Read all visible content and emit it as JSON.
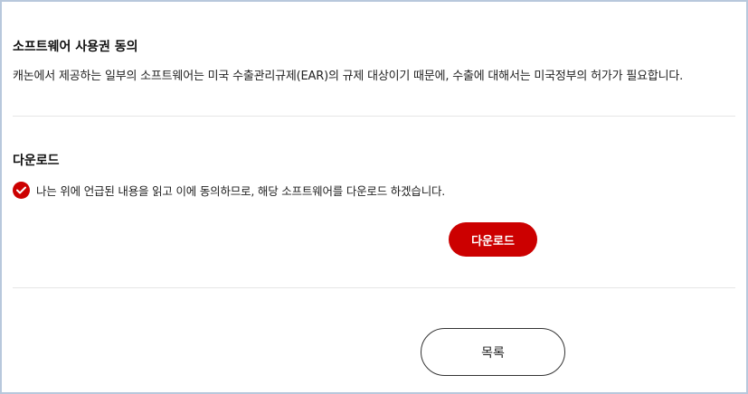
{
  "license": {
    "title": "소프트웨어 사용권 동의",
    "text": "캐논에서 제공하는 일부의 소프트웨어는 미국 수출관리규제(EAR)의 규제 대상이기 때문에, 수출에 대해서는 미국정부의 허가가 필요합니다."
  },
  "download": {
    "title": "다운로드",
    "agree_label": "나는 위에 언급된 내용을 읽고 이에 동의하므로, 해당 소프트웨어를 다운로드 하겠습니다.",
    "agree_checked": true,
    "button_label": "다운로드"
  },
  "footer": {
    "list_button_label": "목록"
  },
  "colors": {
    "accent": "#cc0000",
    "frame_border": "#b8c8dc",
    "divider": "#e6e6e6"
  },
  "icons": {
    "agree_check": "check-circle-icon"
  }
}
